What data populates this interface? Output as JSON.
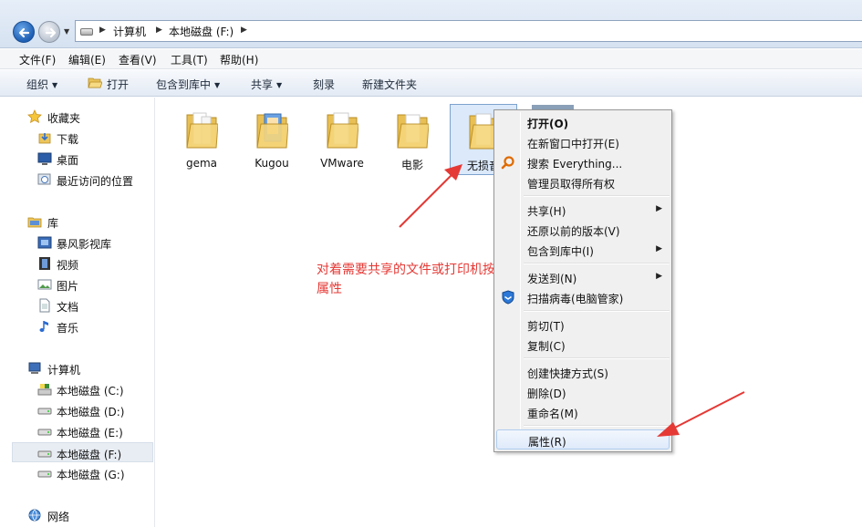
{
  "address": {
    "breadcrumbs": [
      "计算机",
      "本地磁盘 (F:)"
    ]
  },
  "menubar": {
    "items": [
      "文件(F)",
      "编辑(E)",
      "查看(V)",
      "工具(T)",
      "帮助(H)"
    ]
  },
  "toolbar": {
    "organize": "组织",
    "open": "打开",
    "include_in_library": "包含到库中",
    "share": "共享",
    "burn": "刻录",
    "new_folder": "新建文件夹"
  },
  "sidebar": {
    "favorites": {
      "header": "收藏夹",
      "items": [
        "下载",
        "桌面",
        "最近访问的位置"
      ]
    },
    "libraries": {
      "header": "库",
      "items": [
        "暴风影视库",
        "视频",
        "图片",
        "文档",
        "音乐"
      ]
    },
    "computer": {
      "header": "计算机",
      "items": [
        "本地磁盘 (C:)",
        "本地磁盘 (D:)",
        "本地磁盘 (E:)",
        "本地磁盘 (F:)",
        "本地磁盘 (G:)"
      ],
      "selected": "本地磁盘 (F:)"
    },
    "network": {
      "header": "网络"
    }
  },
  "files": [
    "gema",
    "Kugou",
    "VMware",
    "电影",
    "无损音"
  ],
  "annotation": "对着需要共享的文件或打印机按右键-属性",
  "context_menu": {
    "open": "打开(O)",
    "open_new_window": "在新窗口中打开(E)",
    "search_everything": "搜索 Everything...",
    "take_ownership": "管理员取得所有权",
    "share": "共享(H)",
    "restore_previous": "还原以前的版本(V)",
    "include_in_library": "包含到库中(I)",
    "send_to": "发送到(N)",
    "scan_virus": "扫描病毒(电脑管家)",
    "cut": "剪切(T)",
    "copy": "复制(C)",
    "create_shortcut": "创建快捷方式(S)",
    "delete": "删除(D)",
    "rename": "重命名(M)",
    "properties": "属性(R)"
  },
  "colors": {
    "annotation": "#e53935",
    "accent": "#1e5fb4",
    "folder": "#f3d27a"
  }
}
